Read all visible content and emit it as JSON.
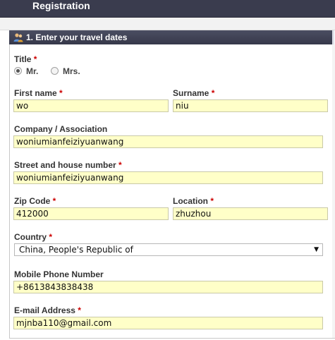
{
  "header": {
    "title": "Registration"
  },
  "section": {
    "title": "1. Enter your travel dates"
  },
  "required_mark": "*",
  "form": {
    "title": {
      "label": "Title",
      "options": [
        {
          "label": "Mr.",
          "selected": true
        },
        {
          "label": "Mrs.",
          "selected": false
        }
      ]
    },
    "first_name": {
      "label": "First name",
      "value": "wo"
    },
    "surname": {
      "label": "Surname",
      "value": "niu"
    },
    "company": {
      "label": "Company / Association",
      "value": "woniumianfeiziyuanwang"
    },
    "street": {
      "label": "Street and house number",
      "value": "woniumianfeiziyuanwang"
    },
    "zip": {
      "label": "Zip Code",
      "value": "412000"
    },
    "location": {
      "label": "Location",
      "value": "zhuzhou"
    },
    "country": {
      "label": "Country",
      "selected": "China, People's Republic of"
    },
    "mobile": {
      "label": "Mobile Phone Number",
      "value": "+8613843838438"
    },
    "email": {
      "label": "E-mail Address",
      "value": "mjnba110@gmail.com"
    }
  },
  "colors": {
    "header_bg": "#3a3c4e",
    "input_bg": "#ffffc8",
    "required": "#cc0000"
  },
  "icons": {
    "section": "users-icon",
    "dropdown": "triangle-down-icon"
  }
}
